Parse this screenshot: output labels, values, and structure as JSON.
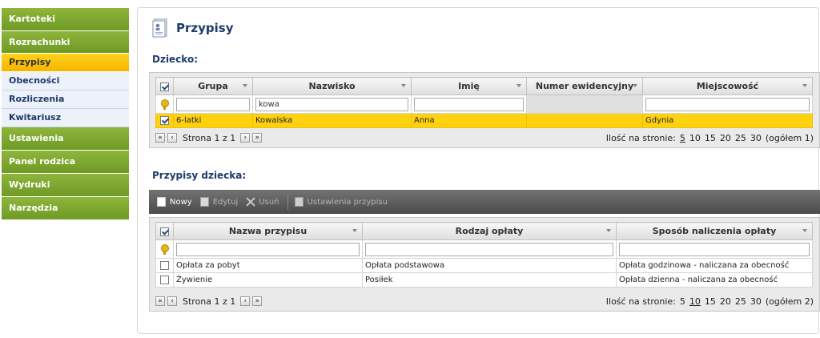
{
  "sidebar": {
    "items": [
      {
        "label": "Kartoteki"
      },
      {
        "label": "Rozrachunki"
      },
      {
        "label": "Przypisy"
      },
      {
        "label": "Obecności"
      },
      {
        "label": "Rozliczenia"
      },
      {
        "label": "Kwitariusz"
      },
      {
        "label": "Ustawienia"
      },
      {
        "label": "Panel rodzica"
      },
      {
        "label": "Wydruki"
      },
      {
        "label": "Narzędzia"
      }
    ],
    "active": "Przypisy",
    "colors": {
      "green": "#7aa52c",
      "active": "#ffc800",
      "sub": "#ecf1fa"
    }
  },
  "page": {
    "title": "Przypisy",
    "icon": "document-user-icon"
  },
  "children": {
    "section_label": "Dziecko:",
    "columns": [
      "Grupa",
      "Nazwisko",
      "Imię",
      "Numer ewidencyjny",
      "Miejscowość"
    ],
    "filters": [
      "",
      "kowa",
      "",
      "",
      ""
    ],
    "rows": [
      {
        "checked": true,
        "cells": [
          "6-latki",
          "Kowalska",
          "Anna",
          "",
          "Gdynia"
        ]
      }
    ],
    "pager": {
      "first": "«",
      "prev": "‹",
      "next": "›",
      "last": "»",
      "info": "Strona 1 z 1",
      "size_label": "Ilość na stronie:",
      "sizes": [
        "5",
        "10",
        "15",
        "20",
        "25",
        "30"
      ],
      "current_size": "5",
      "total": "(ogółem 1)"
    }
  },
  "assignments": {
    "section_label": "Przypisy dziecka:",
    "toolbar": {
      "new": "Nowy",
      "edit": "Edytuj",
      "delete": "Usuń",
      "settings": "Ustawienia przypisu"
    },
    "columns": [
      "Nazwa przypisu",
      "Rodzaj opłaty",
      "Sposób naliczenia opłaty"
    ],
    "filters": [
      "",
      "",
      ""
    ],
    "rows": [
      {
        "checked": false,
        "cells": [
          "Opłata za pobyt",
          "Opłata podstawowa",
          "Opłata godzinowa - naliczana za obecność"
        ]
      },
      {
        "checked": false,
        "cells": [
          "Żywienie",
          "Posiłek",
          "Opłata dzienna - naliczana za obecność"
        ]
      }
    ],
    "pager": {
      "first": "«",
      "prev": "‹",
      "next": "›",
      "last": "»",
      "info": "Strona 1 z 1",
      "size_label": "Ilość na stronie:",
      "sizes": [
        "5",
        "10",
        "15",
        "20",
        "25",
        "30"
      ],
      "current_size": "10",
      "total": "(ogółem 2)"
    }
  }
}
